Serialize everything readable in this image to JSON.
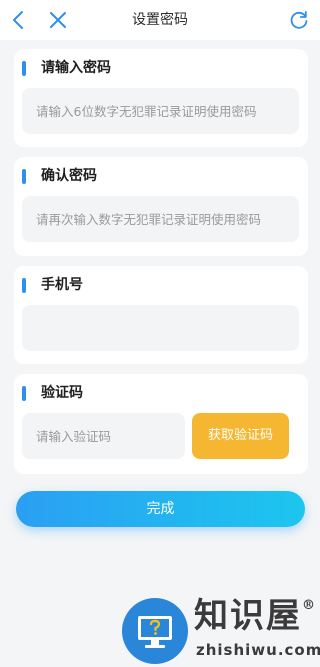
{
  "nav": {
    "title": "设置密码"
  },
  "password": {
    "label": "请输入密码",
    "placeholder": "请输入6位数字无犯罪记录证明使用密码",
    "value": ""
  },
  "confirm": {
    "label": "确认密码",
    "placeholder": "请再次输入数字无犯罪记录证明使用密码",
    "value": ""
  },
  "phone": {
    "label": "手机号",
    "placeholder": "",
    "value": ""
  },
  "code": {
    "label": "验证码",
    "placeholder": "请输入验证码",
    "value": "",
    "button_label": "获取验证码"
  },
  "submit_label": "完成",
  "watermark": {
    "title": "知识屋",
    "subtitle": "zhishiwu.com",
    "registered": "®"
  },
  "colors": {
    "accent": "#2f8ff0",
    "code_button": "#f5b731",
    "submit_start": "#2b9ff3",
    "submit_end": "#1cc6ee"
  },
  "icons": [
    "back-icon",
    "close-icon",
    "refresh-icon",
    "question-computer-icon"
  ]
}
